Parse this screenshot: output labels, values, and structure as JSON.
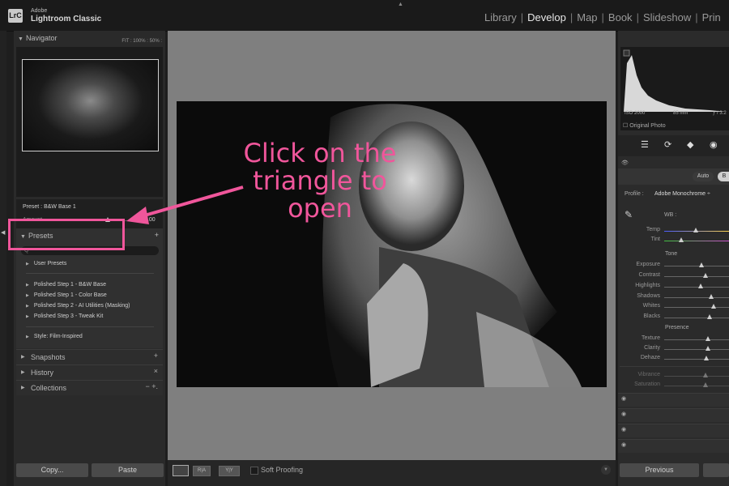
{
  "app": {
    "brand_small": "Adobe",
    "brand_name": "Lightroom Classic",
    "logo_text": "LrC"
  },
  "modules": [
    {
      "label": "Library",
      "active": false
    },
    {
      "label": "Develop",
      "active": true
    },
    {
      "label": "Map",
      "active": false
    },
    {
      "label": "Book",
      "active": false
    },
    {
      "label": "Slideshow",
      "active": false
    },
    {
      "label": "Prin",
      "active": false
    }
  ],
  "left": {
    "navigator": {
      "title": "Navigator",
      "zoom_options": "FIT : 100% : 50% :"
    },
    "preset_info": {
      "preset": "Preset : B&W Base 1",
      "amount_label": "Amount",
      "amount_value": "100"
    },
    "presets": {
      "title": "Presets",
      "search_placeholder": "Q",
      "items": [
        "User Presets",
        "Polished Step 1 - B&W Base",
        "Polished Step 1 - Color Base",
        "Polished Step 2 - AI Utilities (Masking)",
        "Polished Step 3 - Tweak Kit",
        "Style: Film-Inspired"
      ]
    },
    "snapshots": {
      "title": "Snapshots",
      "action": "+"
    },
    "history": {
      "title": "History",
      "action": "×"
    },
    "collections": {
      "title": "Collections",
      "action": "− +."
    },
    "copy_label": "Copy...",
    "paste_label": "Paste"
  },
  "toolbar": {
    "soft_proofing": "Soft Proofing",
    "ra": "R|A",
    "yy": "Y|Y"
  },
  "right": {
    "histogram": {
      "iso": "ISO 2000",
      "focal": "85 mm",
      "aperture": "ƒ / 3.2",
      "original_photo": "Original Photo"
    },
    "auto_label": "Auto",
    "bw_label": "B",
    "profile_label": "Profile :",
    "profile_value": "Adobe Monochrome ÷",
    "wb_label": "WB :",
    "temp": "Temp",
    "tint": "Tint",
    "tone_label": "Tone",
    "exposure": "Exposure",
    "contrast": "Contrast",
    "highlights": "Highlights",
    "shadows": "Shadows",
    "whites": "Whites",
    "blacks": "Blacks",
    "presence_label": "Presence",
    "texture": "Texture",
    "clarity": "Clarity",
    "dehaze": "Dehaze",
    "vibrance": "Vibrance",
    "saturation": "Saturation",
    "previous_label": "Previous"
  },
  "annotation": {
    "text": "Click on the triangle to open",
    "color": "#f0569b"
  }
}
